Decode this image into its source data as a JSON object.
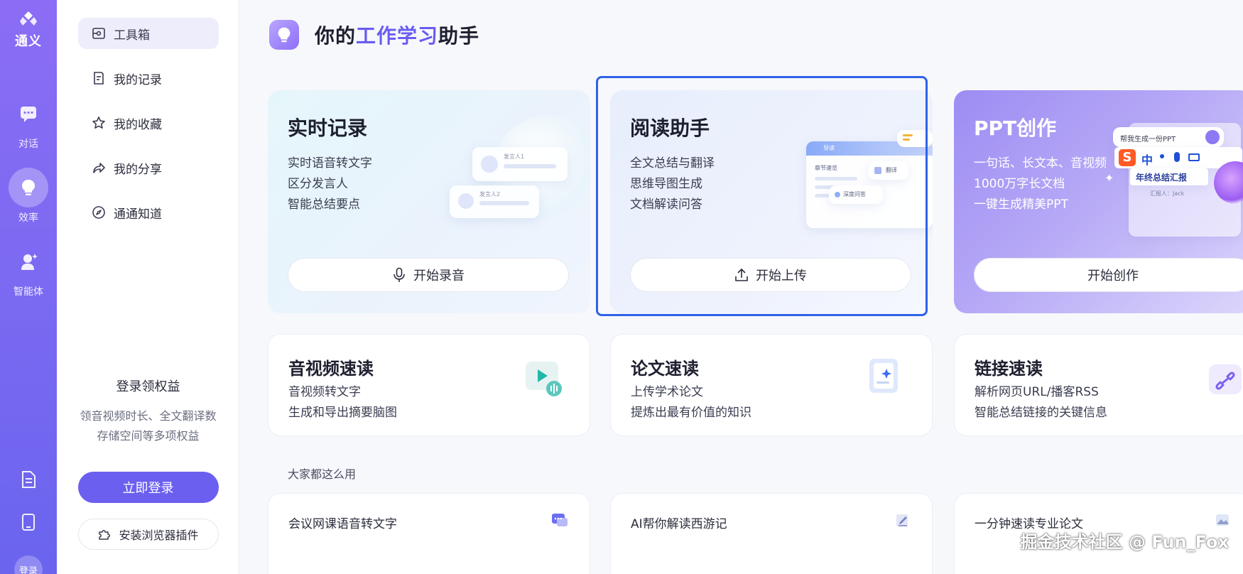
{
  "rail": {
    "brand": "通义",
    "items": [
      {
        "label": "对话",
        "icon": "chat-icon"
      },
      {
        "label": "效率",
        "icon": "bulb-icon"
      },
      {
        "label": "智能体",
        "icon": "agent-icon"
      }
    ],
    "avatar_label": "登录"
  },
  "sidebar": {
    "items": [
      {
        "label": "工具箱",
        "icon": "toolbox-icon"
      },
      {
        "label": "我的记录",
        "icon": "record-icon"
      },
      {
        "label": "我的收藏",
        "icon": "star-icon"
      },
      {
        "label": "我的分享",
        "icon": "share-icon"
      },
      {
        "label": "通通知道",
        "icon": "compass-icon"
      }
    ],
    "login_title": "登录领权益",
    "login_desc_1": "领音视频时长、全文翻译数",
    "login_desc_2": "存储空间等多项权益",
    "login_button": "立即登录",
    "extension_button": "安装浏览器插件"
  },
  "header": {
    "title_prefix": "你的",
    "title_accent": "工作学习",
    "title_suffix": "助手"
  },
  "big_cards": [
    {
      "title": "实时记录",
      "lines": [
        "实时语音转文字",
        "区分发言人",
        "智能总结要点"
      ],
      "cta": "开始录音",
      "illus": {
        "speaker1": "发言人1",
        "speaker2": "发言人2"
      }
    },
    {
      "title": "阅读助手",
      "lines": [
        "全文总结与翻译",
        "思维导图生成",
        "文档解读问答"
      ],
      "cta": "开始上传",
      "illus": {
        "guide": "导读",
        "chapter": "章节速览",
        "translate": "翻译",
        "qa": "深度问答"
      }
    },
    {
      "title": "PPT创作",
      "lines": [
        "一句话、长文本、音视频",
        "1000万字长文档",
        "一键生成精美PPT"
      ],
      "cta": "开始创作",
      "illus": {
        "prompt": "帮我生成一份PPT",
        "doc_title": "年终总结汇报",
        "reporter": "汇报人：Jack",
        "ime_label": "中"
      }
    }
  ],
  "mid_cards": [
    {
      "title": "音视频速读",
      "lines": [
        "音视频转文字",
        "生成和导出摘要脑图"
      ]
    },
    {
      "title": "论文速读",
      "lines": [
        "上传学术论文",
        "提炼出最有价值的知识"
      ]
    },
    {
      "title": "链接速读",
      "lines": [
        "解析网页URL/播客RSS",
        "智能总结链接的关键信息"
      ]
    }
  ],
  "section_title": "大家都这么用",
  "usage_cards": [
    {
      "title": "会议网课语音转文字"
    },
    {
      "title": "AI帮你解读西游记"
    },
    {
      "title": "一分钟速读专业论文"
    }
  ],
  "watermark": "掘金技术社区 @ Fun_Fox",
  "colors": {
    "accent": "#6a5cf0",
    "rail": "#7d6af2",
    "focus": "#2f62e8"
  }
}
